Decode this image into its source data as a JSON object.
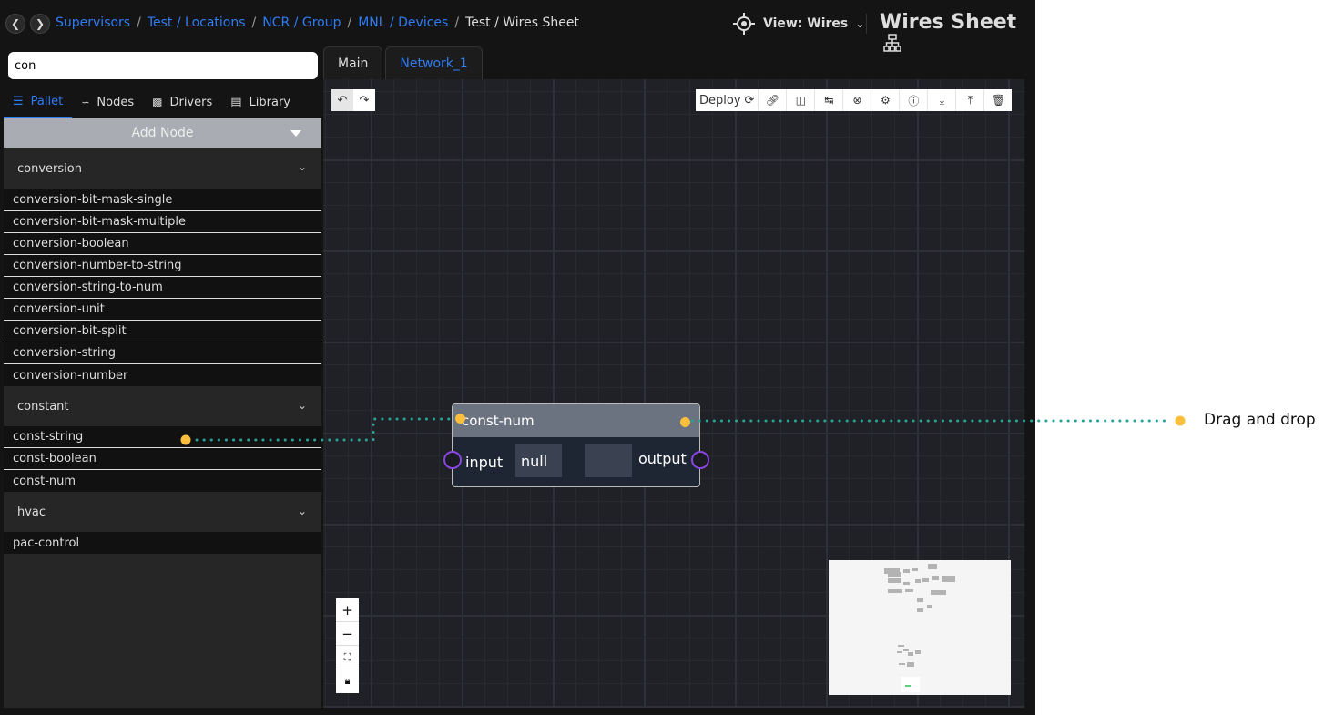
{
  "breadcrumb": {
    "links": [
      "Supervisors",
      "Test / Locations",
      "NCR / Group",
      "MNL / Devices"
    ],
    "current": "Test / Wires Sheet"
  },
  "header": {
    "view_label": "View: Wires",
    "title": "Wires Sheet"
  },
  "search": {
    "value": "con"
  },
  "panel_tabs": [
    {
      "label": "Pallet",
      "icon": "list-icon",
      "active": true
    },
    {
      "label": "Nodes",
      "icon": "nodes-icon"
    },
    {
      "label": "Drivers",
      "icon": "hierarchy-icon"
    },
    {
      "label": "Library",
      "icon": "library-icon"
    }
  ],
  "add_node_label": "Add Node",
  "groups": [
    {
      "name": "conversion",
      "items": [
        "conversion-bit-mask-single",
        "conversion-bit-mask-multiple",
        "conversion-boolean",
        "conversion-number-to-string",
        "conversion-string-to-num",
        "conversion-unit",
        "conversion-bit-split",
        "conversion-string",
        "conversion-number"
      ]
    },
    {
      "name": "constant",
      "items": [
        "const-string",
        "const-boolean",
        "const-num"
      ]
    },
    {
      "name": "hvac",
      "items": [
        "pac-control"
      ]
    }
  ],
  "sheet_tabs": [
    {
      "label": "Main"
    },
    {
      "label": "Network_1"
    }
  ],
  "toolbar": {
    "deploy_label": "Deploy",
    "icons": [
      "refresh-icon",
      "link-icon",
      "group-icon",
      "return-icon",
      "close-circle-icon",
      "gear-icon",
      "help-icon",
      "download-icon",
      "upload-icon",
      "trash-icon"
    ]
  },
  "node": {
    "title": "const-num",
    "input_label": "input",
    "input_value": "null",
    "output_label": "output",
    "output_value": ""
  },
  "annotation": "Drag and drop",
  "colors": {
    "accent": "#2f7cf6",
    "drag_dot": "#fbbf3c",
    "wire": "#2aa198",
    "port": "#8b45e0"
  }
}
